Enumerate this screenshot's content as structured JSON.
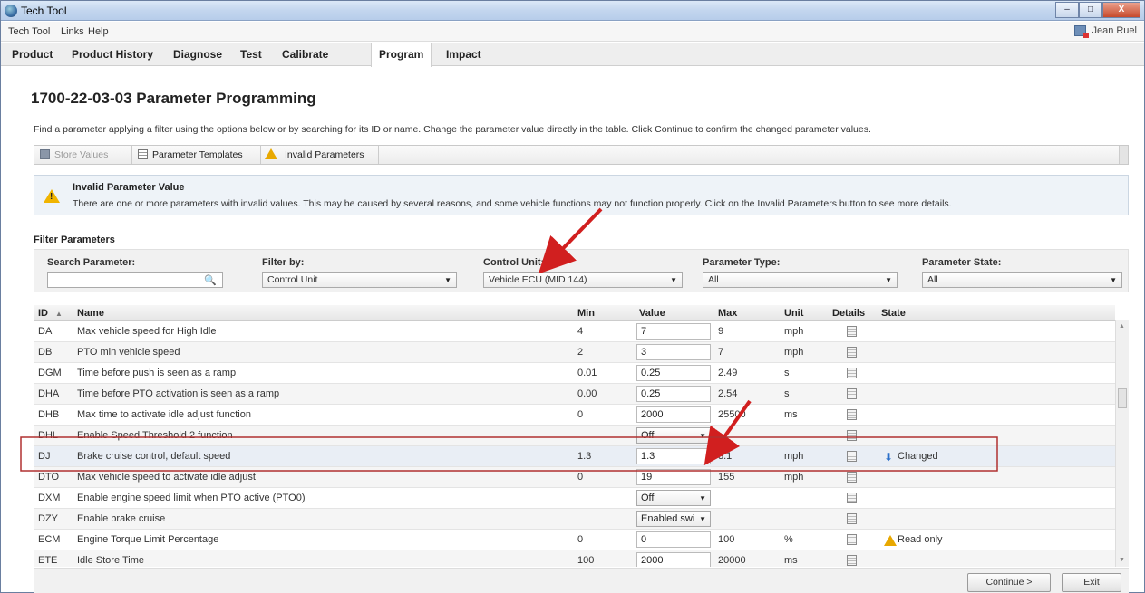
{
  "window": {
    "title": "Tech Tool",
    "buttons": [
      "–",
      "□",
      "X"
    ]
  },
  "menu": {
    "items": [
      "Tech Tool",
      "Links",
      "Help"
    ],
    "user": "Jean Ruel"
  },
  "tabs": [
    "Product",
    "Product History",
    "Diagnose",
    "Test",
    "Calibrate",
    "Program",
    "Impact"
  ],
  "active_tab": "Program",
  "page": {
    "title": "1700-22-03-03 Parameter Programming",
    "description": "Find a parameter applying a filter using the options below or by searching for its ID or name. Change the parameter value directly in the table. Click Continue to confirm the changed parameter values."
  },
  "toolbar": {
    "store_values": "Store Values",
    "parameter_templates": "Parameter Templates",
    "invalid_parameters": "Invalid Parameters"
  },
  "warning": {
    "title": "Invalid Parameter Value",
    "text": "There are one or more parameters with invalid values. This may be caused by several reasons, and some vehicle functions may not function properly. Click on the Invalid Parameters button to see more details."
  },
  "filters": {
    "heading": "Filter Parameters",
    "search_label": "Search Parameter:",
    "search_value": "",
    "filter_by_label": "Filter by:",
    "filter_by_value": "Control Unit",
    "control_unit_label": "Control Unit:",
    "control_unit_value": "Vehicle ECU (MID 144)",
    "parameter_type_label": "Parameter Type:",
    "parameter_type_value": "All",
    "parameter_state_label": "Parameter State:",
    "parameter_state_value": "All"
  },
  "table": {
    "headers": {
      "id": "ID",
      "name": "Name",
      "min": "Min",
      "value": "Value",
      "max": "Max",
      "unit": "Unit",
      "details": "Details",
      "state": "State"
    },
    "rows": [
      {
        "id": "DA",
        "name": "Max vehicle speed for High Idle",
        "min": "4",
        "value": "7",
        "value_type": "input",
        "max": "9",
        "unit": "mph",
        "state": ""
      },
      {
        "id": "DB",
        "name": "PTO min vehicle speed",
        "min": "2",
        "value": "3",
        "value_type": "input",
        "max": "7",
        "unit": "mph",
        "state": ""
      },
      {
        "id": "DGM",
        "name": "Time before push is seen as a ramp",
        "min": "0.01",
        "value": "0.25",
        "value_type": "input",
        "max": "2.49",
        "unit": "s",
        "state": ""
      },
      {
        "id": "DHA",
        "name": "Time before PTO activation is seen as a ramp",
        "min": "0.00",
        "value": "0.25",
        "value_type": "input",
        "max": "2.54",
        "unit": "s",
        "state": ""
      },
      {
        "id": "DHB",
        "name": "Max time to activate idle adjust function",
        "min": "0",
        "value": "2000",
        "value_type": "input",
        "max": "25500",
        "unit": "ms",
        "state": ""
      },
      {
        "id": "DHL",
        "name": "Enable Speed Threshold 2 function",
        "min": "",
        "value": "Off",
        "value_type": "select",
        "max": "",
        "unit": "",
        "state": ""
      },
      {
        "id": "DJ",
        "name": "Brake cruise control, default speed",
        "min": "1.3",
        "value": "1.3",
        "value_type": "input",
        "max": "3.1",
        "unit": "mph",
        "state": "Changed",
        "state_icon": "info-arrow-icon"
      },
      {
        "id": "DTO",
        "name": "Max vehicle speed to activate idle adjust",
        "min": "0",
        "value": "19",
        "value_type": "input",
        "max": "155",
        "unit": "mph",
        "state": ""
      },
      {
        "id": "DXM",
        "name": "Enable engine speed limit when PTO active (PTO0)",
        "min": "",
        "value": "Off",
        "value_type": "select",
        "max": "",
        "unit": "",
        "state": ""
      },
      {
        "id": "DZY",
        "name": "Enable brake cruise",
        "min": "",
        "value": "Enabled swi",
        "value_type": "select",
        "max": "",
        "unit": "",
        "state": ""
      },
      {
        "id": "ECM",
        "name": "Engine Torque Limit Percentage",
        "min": "0",
        "value": "0",
        "value_type": "input",
        "max": "100",
        "unit": "%",
        "state": "Read only",
        "state_icon": "warning-icon"
      },
      {
        "id": "ETE",
        "name": "Idle Store Time",
        "min": "100",
        "value": "2000",
        "value_type": "input",
        "max": "20000",
        "unit": "ms",
        "state": ""
      }
    ]
  },
  "footer": {
    "continue": "Continue >",
    "exit": "Exit"
  },
  "colors": {
    "annotation_red": "#d11f1f",
    "highlight_box": "#b03030",
    "warning_yellow": "#f0b400"
  }
}
